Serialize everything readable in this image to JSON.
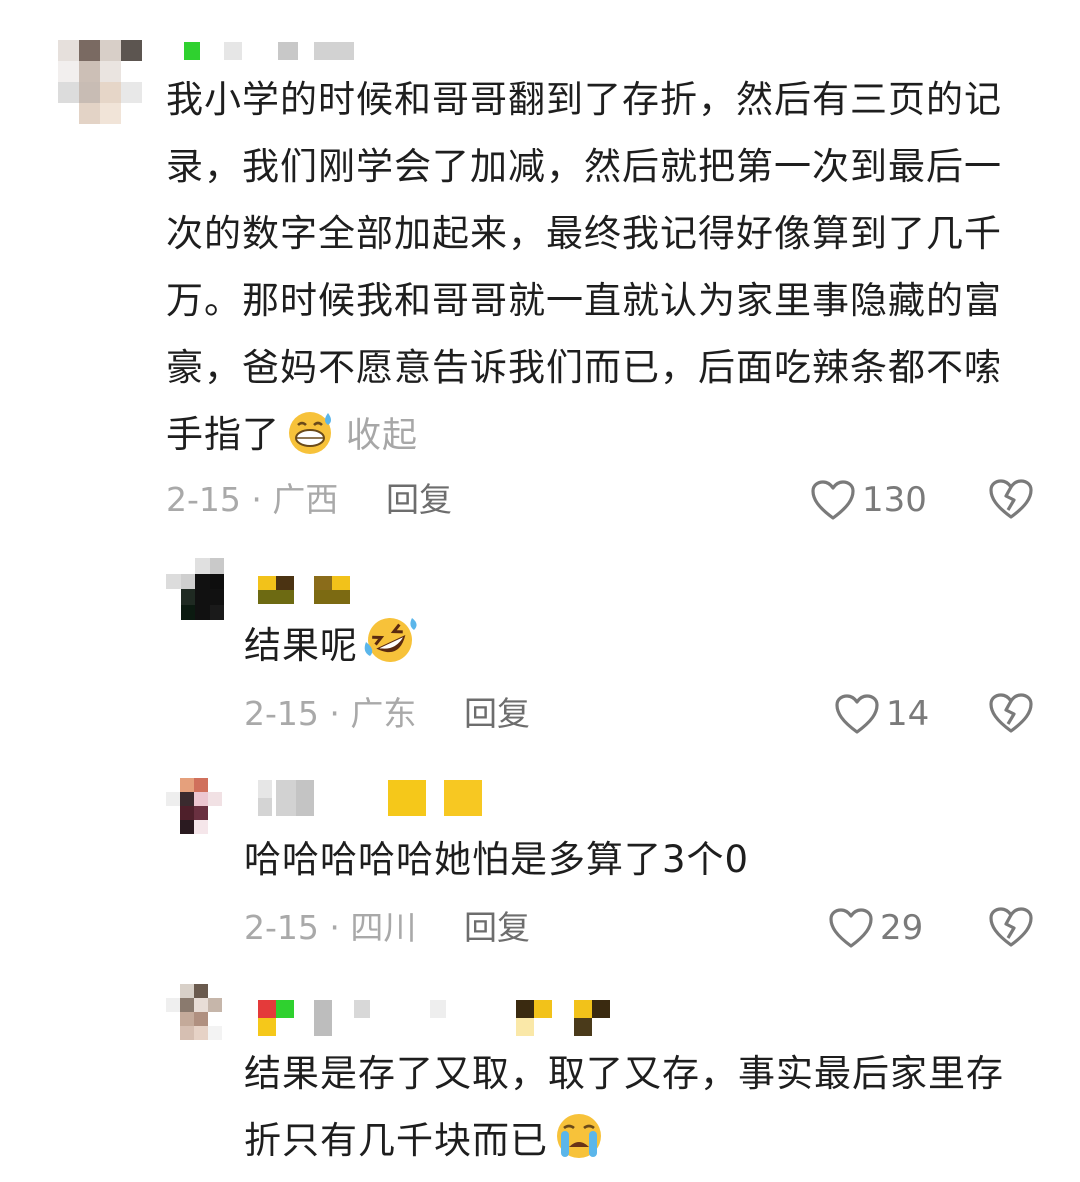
{
  "comments": [
    {
      "text": "我小学的时候和哥哥翻到了存折，然后有三页的记录，我们刚学会了加减，然后就把第一次到最后一次的数字全部加起来，最终我记得好像算到了几千万。那时候我和哥哥就一直就认为家里事隐藏的富豪，爸妈不愿意告诉我们而已，后面吃辣条都不嗦手指了",
      "emoji": "grinning-sweat-emoji",
      "collapse_label": "收起",
      "date_location": "2-15 · 广西",
      "reply_label": "回复",
      "likes": "130"
    },
    {
      "text": "结果呢",
      "emoji": "rofl-emoji",
      "date_location": "2-15 · 广东",
      "reply_label": "回复",
      "likes": "14"
    },
    {
      "text": "哈哈哈哈哈她怕是多算了3个0",
      "date_location": "2-15 · 四川",
      "reply_label": "回复",
      "likes": "29"
    },
    {
      "text": "结果是存了又取，取了又存，事实最后家里存折只有几千块而已",
      "emoji": "crying-emoji",
      "date_location": "",
      "reply_label": "",
      "likes": ""
    }
  ],
  "icons": {
    "like": "heart-outline-icon",
    "dislike": "broken-heart-icon"
  },
  "colors": {
    "text": "#1e1e1e",
    "meta": "#a9a9a9",
    "collapse": "#a7a7a7",
    "reply": "#6d6d6d"
  }
}
